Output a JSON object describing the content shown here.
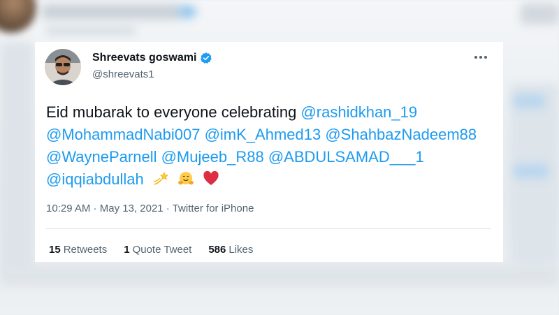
{
  "tweet": {
    "author_name": "Shreevats goswami",
    "handle": "@shreevats1",
    "verified_icon": "verified-badge-icon",
    "more_icon": "more-options-icon",
    "text_intro": "Eid mubarak to everyone celebrating",
    "mentions": [
      "@rashidkhan_19",
      "@MohammadNabi007",
      "@imK_Ahmed13",
      "@ShahbazNadeem88",
      "@WayneParnell",
      "@Mujeeb_R88",
      "@ABDULSAMAD___1",
      "@iqqiabdullah"
    ],
    "emojis": [
      "dizzy-star-icon",
      "hugging-face-icon",
      "red-heart-icon"
    ],
    "time": "10:29 AM",
    "date": "May 13, 2021",
    "source": "Twitter for iPhone",
    "separator": " · "
  },
  "stats": {
    "retweets_count": "15",
    "retweets_label": "Retweets",
    "quotes_count": "1",
    "quotes_label": "Quote Tweet",
    "likes_count": "586",
    "likes_label": "Likes"
  },
  "colors": {
    "link": "#1d9bf0",
    "secondary_text": "#536471",
    "primary_text": "#0f1419",
    "verified": "#1d9bf0"
  }
}
